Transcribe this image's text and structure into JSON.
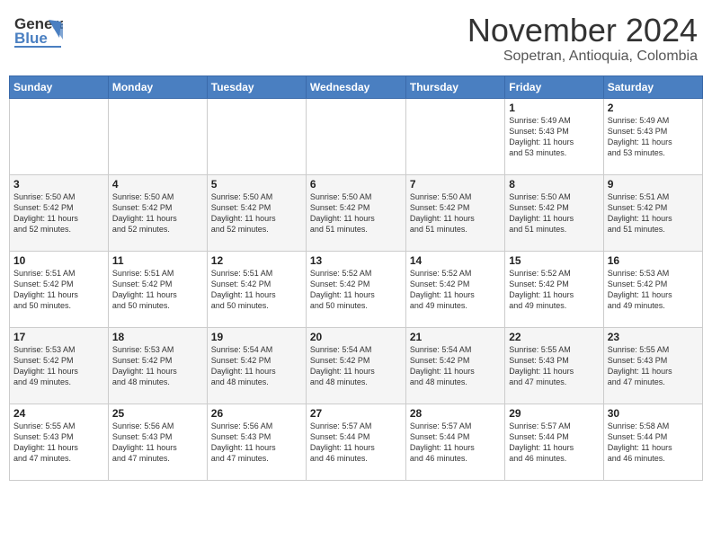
{
  "header": {
    "logo_line1": "General",
    "logo_line2": "Blue",
    "month_title": "November 2024",
    "location": "Sopetran, Antioquia, Colombia"
  },
  "calendar": {
    "weekdays": [
      "Sunday",
      "Monday",
      "Tuesday",
      "Wednesday",
      "Thursday",
      "Friday",
      "Saturday"
    ],
    "weeks": [
      [
        {
          "day": "",
          "info": ""
        },
        {
          "day": "",
          "info": ""
        },
        {
          "day": "",
          "info": ""
        },
        {
          "day": "",
          "info": ""
        },
        {
          "day": "",
          "info": ""
        },
        {
          "day": "1",
          "info": "Sunrise: 5:49 AM\nSunset: 5:43 PM\nDaylight: 11 hours\nand 53 minutes."
        },
        {
          "day": "2",
          "info": "Sunrise: 5:49 AM\nSunset: 5:43 PM\nDaylight: 11 hours\nand 53 minutes."
        }
      ],
      [
        {
          "day": "3",
          "info": "Sunrise: 5:50 AM\nSunset: 5:42 PM\nDaylight: 11 hours\nand 52 minutes."
        },
        {
          "day": "4",
          "info": "Sunrise: 5:50 AM\nSunset: 5:42 PM\nDaylight: 11 hours\nand 52 minutes."
        },
        {
          "day": "5",
          "info": "Sunrise: 5:50 AM\nSunset: 5:42 PM\nDaylight: 11 hours\nand 52 minutes."
        },
        {
          "day": "6",
          "info": "Sunrise: 5:50 AM\nSunset: 5:42 PM\nDaylight: 11 hours\nand 51 minutes."
        },
        {
          "day": "7",
          "info": "Sunrise: 5:50 AM\nSunset: 5:42 PM\nDaylight: 11 hours\nand 51 minutes."
        },
        {
          "day": "8",
          "info": "Sunrise: 5:50 AM\nSunset: 5:42 PM\nDaylight: 11 hours\nand 51 minutes."
        },
        {
          "day": "9",
          "info": "Sunrise: 5:51 AM\nSunset: 5:42 PM\nDaylight: 11 hours\nand 51 minutes."
        }
      ],
      [
        {
          "day": "10",
          "info": "Sunrise: 5:51 AM\nSunset: 5:42 PM\nDaylight: 11 hours\nand 50 minutes."
        },
        {
          "day": "11",
          "info": "Sunrise: 5:51 AM\nSunset: 5:42 PM\nDaylight: 11 hours\nand 50 minutes."
        },
        {
          "day": "12",
          "info": "Sunrise: 5:51 AM\nSunset: 5:42 PM\nDaylight: 11 hours\nand 50 minutes."
        },
        {
          "day": "13",
          "info": "Sunrise: 5:52 AM\nSunset: 5:42 PM\nDaylight: 11 hours\nand 50 minutes."
        },
        {
          "day": "14",
          "info": "Sunrise: 5:52 AM\nSunset: 5:42 PM\nDaylight: 11 hours\nand 49 minutes."
        },
        {
          "day": "15",
          "info": "Sunrise: 5:52 AM\nSunset: 5:42 PM\nDaylight: 11 hours\nand 49 minutes."
        },
        {
          "day": "16",
          "info": "Sunrise: 5:53 AM\nSunset: 5:42 PM\nDaylight: 11 hours\nand 49 minutes."
        }
      ],
      [
        {
          "day": "17",
          "info": "Sunrise: 5:53 AM\nSunset: 5:42 PM\nDaylight: 11 hours\nand 49 minutes."
        },
        {
          "day": "18",
          "info": "Sunrise: 5:53 AM\nSunset: 5:42 PM\nDaylight: 11 hours\nand 48 minutes."
        },
        {
          "day": "19",
          "info": "Sunrise: 5:54 AM\nSunset: 5:42 PM\nDaylight: 11 hours\nand 48 minutes."
        },
        {
          "day": "20",
          "info": "Sunrise: 5:54 AM\nSunset: 5:42 PM\nDaylight: 11 hours\nand 48 minutes."
        },
        {
          "day": "21",
          "info": "Sunrise: 5:54 AM\nSunset: 5:42 PM\nDaylight: 11 hours\nand 48 minutes."
        },
        {
          "day": "22",
          "info": "Sunrise: 5:55 AM\nSunset: 5:43 PM\nDaylight: 11 hours\nand 47 minutes."
        },
        {
          "day": "23",
          "info": "Sunrise: 5:55 AM\nSunset: 5:43 PM\nDaylight: 11 hours\nand 47 minutes."
        }
      ],
      [
        {
          "day": "24",
          "info": "Sunrise: 5:55 AM\nSunset: 5:43 PM\nDaylight: 11 hours\nand 47 minutes."
        },
        {
          "day": "25",
          "info": "Sunrise: 5:56 AM\nSunset: 5:43 PM\nDaylight: 11 hours\nand 47 minutes."
        },
        {
          "day": "26",
          "info": "Sunrise: 5:56 AM\nSunset: 5:43 PM\nDaylight: 11 hours\nand 47 minutes."
        },
        {
          "day": "27",
          "info": "Sunrise: 5:57 AM\nSunset: 5:44 PM\nDaylight: 11 hours\nand 46 minutes."
        },
        {
          "day": "28",
          "info": "Sunrise: 5:57 AM\nSunset: 5:44 PM\nDaylight: 11 hours\nand 46 minutes."
        },
        {
          "day": "29",
          "info": "Sunrise: 5:57 AM\nSunset: 5:44 PM\nDaylight: 11 hours\nand 46 minutes."
        },
        {
          "day": "30",
          "info": "Sunrise: 5:58 AM\nSunset: 5:44 PM\nDaylight: 11 hours\nand 46 minutes."
        }
      ]
    ]
  }
}
